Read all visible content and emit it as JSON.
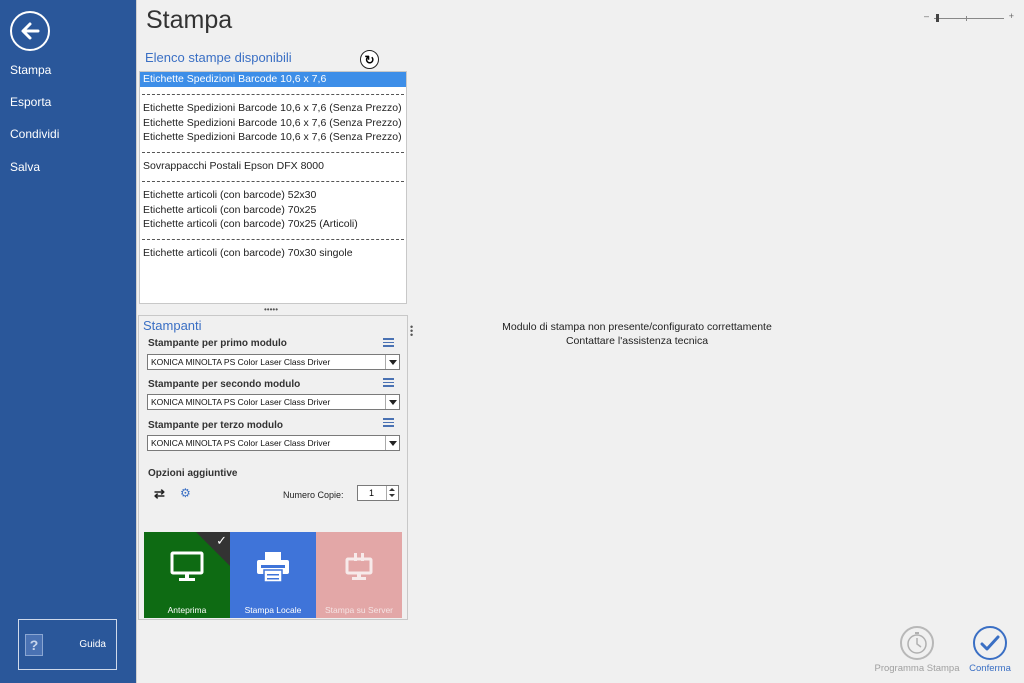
{
  "sidebar": {
    "back_icon": "arrow-left-icon",
    "items": [
      {
        "label": "Stampa"
      },
      {
        "label": "Esporta"
      },
      {
        "label": "Condividi"
      },
      {
        "label": "Salva"
      }
    ],
    "help": {
      "label": "Guida",
      "icon": "question-icon"
    }
  },
  "page": {
    "title": "Stampa",
    "zoom": {
      "minus": "–",
      "plus": "+"
    }
  },
  "print_list": {
    "header": "Elenco stampe disponibili",
    "rows": [
      {
        "label": "Etichette Spedizioni Barcode 10,6 x 7,6",
        "selected": true
      },
      {
        "separator": true
      },
      {
        "label": "Etichette Spedizioni Barcode 10,6 x 7,6 (Senza Prezzo)"
      },
      {
        "label": "Etichette Spedizioni Barcode 10,6 x 7,6 (Senza Prezzo)"
      },
      {
        "label": "Etichette Spedizioni Barcode 10,6 x 7,6 (Senza Prezzo)"
      },
      {
        "separator": true
      },
      {
        "label": "Sovrappacchi Postali Epson DFX 8000"
      },
      {
        "separator": true
      },
      {
        "label": "Etichette articoli (con barcode) 52x30"
      },
      {
        "label": "Etichette articoli (con barcode) 70x25"
      },
      {
        "label": "Etichette articoli (con barcode) 70x25 (Articoli)"
      },
      {
        "separator": true
      },
      {
        "label": "Etichette articoli (con barcode) 70x30 singole"
      }
    ]
  },
  "printers": {
    "title": "Stampanti",
    "first": {
      "label": "Stampante per primo modulo",
      "value": "KONICA MINOLTA PS Color Laser Class Driver"
    },
    "second": {
      "label": "Stampante per secondo modulo",
      "value": "KONICA MINOLTA PS Color Laser Class Driver"
    },
    "third": {
      "label": "Stampante per terzo modulo",
      "value": "KONICA MINOLTA PS Color Laser Class Driver"
    },
    "options_title": "Opzioni aggiuntive",
    "copies_label": "Numero Copie:",
    "copies_value": "1"
  },
  "tiles": {
    "preview": {
      "label": "Anteprima",
      "icon": "monitor-icon",
      "color": "#0e6b13",
      "checked": true
    },
    "local": {
      "label": "Stampa Locale",
      "icon": "printer-icon",
      "color": "#3f74d9"
    },
    "server": {
      "label": "Stampa su Server",
      "icon": "server-print-icon",
      "color": "#e3a7a7"
    }
  },
  "message": {
    "line1": "Modulo di stampa non presente/configurato correttamente",
    "line2": "Contattare l'assistenza tecnica"
  },
  "actions": {
    "schedule": {
      "label": "Programma Stampa",
      "icon": "clock-icon"
    },
    "confirm": {
      "label": "Conferma",
      "icon": "check-circle-icon"
    }
  }
}
